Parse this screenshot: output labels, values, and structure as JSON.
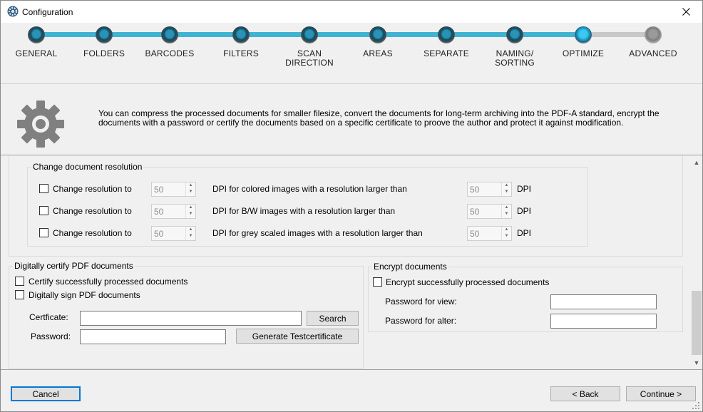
{
  "window": {
    "title": "Configuration"
  },
  "wizard": {
    "steps": [
      {
        "label": "GENERAL",
        "state": "done"
      },
      {
        "label": "FOLDERS",
        "state": "done"
      },
      {
        "label": "BARCODES",
        "state": "done"
      },
      {
        "label": "FILTERS",
        "state": "done"
      },
      {
        "label": "SCAN\nDIRECTION",
        "state": "done"
      },
      {
        "label": "AREAS",
        "state": "done"
      },
      {
        "label": "SEPARATE",
        "state": "done"
      },
      {
        "label": "NAMING/\nSORTING",
        "state": "done"
      },
      {
        "label": "OPTIMIZE",
        "state": "current"
      },
      {
        "label": "ADVANCED",
        "state": "pending"
      }
    ]
  },
  "info": {
    "text": "You can compress the processed documents for smaller filesize, convert the documents for long-term archiving into the PDF-A standard, encrypt the documents with a password or certify the documents based on a specific certificate to proove the author and protect it against modification."
  },
  "resolution": {
    "legend": "Change document resolution",
    "rows": [
      {
        "checkbox_label": "Change resolution to",
        "dpi_value": "50",
        "description": "DPI for colored images with a resolution larger than",
        "threshold_value": "50",
        "unit": "DPI"
      },
      {
        "checkbox_label": "Change resolution to",
        "dpi_value": "50",
        "description": "DPI for B/W images with a resolution larger than",
        "threshold_value": "50",
        "unit": "DPI"
      },
      {
        "checkbox_label": "Change resolution to",
        "dpi_value": "50",
        "description": "DPI for grey scaled images with a resolution larger than",
        "threshold_value": "50",
        "unit": "DPI"
      }
    ]
  },
  "certify": {
    "legend": "Digitally certify PDF documents",
    "certify_label": "Certify successfully processed documents",
    "sign_label": "Digitally sign PDF documents",
    "certificate_label": "Certficate:",
    "certificate_value": "",
    "search_button": "Search",
    "password_label": "Password:",
    "password_value": "",
    "generate_button": "Generate Testcertificate"
  },
  "encrypt": {
    "legend": "Encrypt documents",
    "encrypt_label": "Encrypt successfully processed documents",
    "view_label": "Password for view:",
    "view_value": "",
    "alter_label": "Password for alter:",
    "alter_value": ""
  },
  "footer": {
    "cancel": "Cancel",
    "back": "< Back",
    "continue": "Continue >"
  },
  "colors": {
    "accent": "#41b3d3",
    "focus": "#0078d7"
  }
}
